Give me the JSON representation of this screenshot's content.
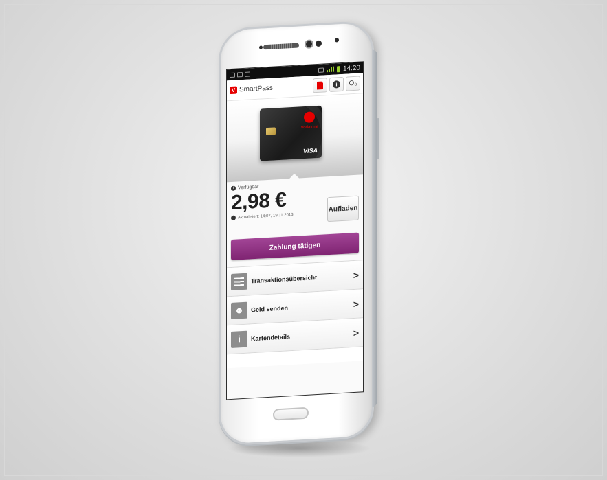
{
  "status_bar": {
    "time": "14:20"
  },
  "app": {
    "name": "SmartPass",
    "logo_glyph": "V",
    "header_icons": [
      "sim-card-icon",
      "info-icon",
      "key-icon"
    ],
    "key_glyph": "O₀",
    "info_glyph": "i"
  },
  "card": {
    "brand": "Vodafone",
    "network": "VISA"
  },
  "balance": {
    "label": "Verfügbar",
    "amount": "2,98 €",
    "updated": "Aktualisiert: 14:07, 19.11.2013",
    "topup_label": "Aufladen"
  },
  "pay_button": {
    "label": "Zahlung tätigen",
    "color": "#8f2f83"
  },
  "menu": {
    "items": [
      {
        "label": "Transaktionsübersicht",
        "icon": "list-icon"
      },
      {
        "label": "Geld senden",
        "icon": "people-icon"
      },
      {
        "label": "Kartendetails",
        "icon": "info-icon",
        "glyph": "i"
      }
    ],
    "chevron": ">"
  },
  "colors": {
    "brand_red": "#e60000",
    "accent_purple": "#8f2f83"
  }
}
